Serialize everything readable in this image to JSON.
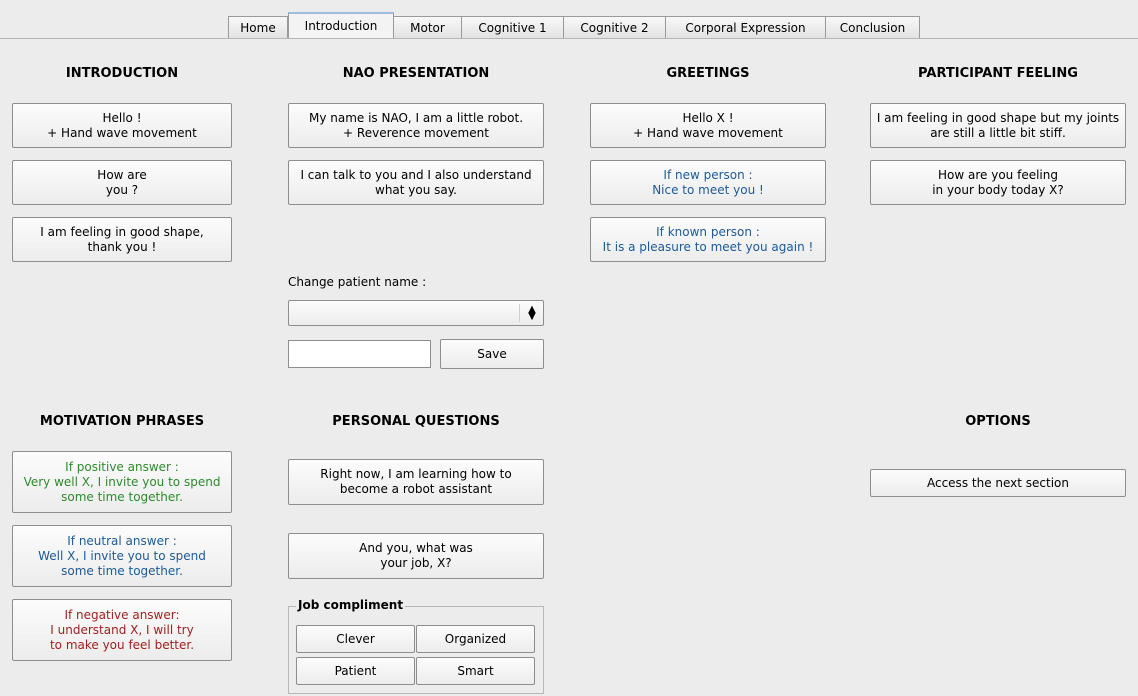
{
  "tabs": [
    "Home",
    "Introduction",
    "Motor",
    "Cognitive 1",
    "Cognitive 2",
    "Corporal Expression",
    "Conclusion"
  ],
  "active_tab": "Introduction",
  "headers": {
    "introduction": "INTRODUCTION",
    "nao_presentation": "NAO PRESENTATION",
    "greetings": "GREETINGS",
    "participant_feeling": "PARTICIPANT FEELING",
    "motivation_phrases": "MOTIVATION PHRASES",
    "personal_questions": "PERSONAL QUESTIONS",
    "options": "OPTIONS"
  },
  "introduction": {
    "hello": [
      "Hello !",
      "+ Hand wave movement"
    ],
    "how_are_you": [
      "How are",
      "you ?"
    ],
    "feeling_good": [
      "I am feeling in good shape,",
      "thank you !"
    ]
  },
  "nao_presentation": {
    "name": [
      "My name is NAO, I am a little robot.",
      "+ Reverence movement"
    ],
    "talk": [
      "I can talk to you and I also understand",
      "what you say."
    ],
    "change_name_label": "Change patient name :",
    "name_value": "",
    "save_label": "Save"
  },
  "greetings": {
    "hello_x": [
      "Hello X !",
      "+ Hand wave movement"
    ],
    "new_person": [
      "If new person :",
      "Nice to meet you !"
    ],
    "known_person": [
      "If known person :",
      "It is a pleasure to meet you again !"
    ]
  },
  "participant_feeling": {
    "joints": [
      "I am feeling in good shape but my joints",
      "are still a little bit stiff."
    ],
    "how_feeling": [
      "How are you feeling",
      "in your body today X?"
    ]
  },
  "motivation": {
    "positive": [
      "If positive answer :",
      "Very well X, I invite you to spend",
      "some time together."
    ],
    "neutral": [
      "If neutral answer :",
      "Well X, I invite you to spend",
      "some time together."
    ],
    "negative": [
      "If negative answer:",
      "I understand X, I will try",
      "to make you feel better."
    ]
  },
  "personal_questions": {
    "learning": [
      "Right now, I am learning how to",
      "become a robot assistant"
    ],
    "job": [
      "And you, what was",
      "your job, X?"
    ],
    "job_compliment_title": "Job compliment",
    "compliments": [
      "Clever",
      "Organized",
      "Patient",
      "Smart"
    ]
  },
  "options": {
    "next_section": "Access the next section"
  },
  "colors": {
    "blue_text": "#1d5a96",
    "green_text": "#2e8a2e",
    "red_text": "#a11f1f"
  }
}
